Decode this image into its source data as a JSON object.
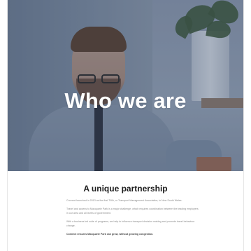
{
  "hero": {
    "title": "Who we are"
  },
  "section": {
    "title": "A unique partnership",
    "paragraphs": [
      "Connect launched in 2013 as the first TMA, or Transport Management Association, in New South Wales.",
      "Travel and access to Macquarie Park is a major challenge, which requires coordination between the leading employers in our area and all levels of government.",
      "With a business led suite of programs, we help to influence transport decision making and promote travel behaviour change."
    ],
    "closing": "Connect ensures Macquarie Park can grow, without growing congestion."
  },
  "colors": {
    "overlay": "#283755",
    "hero_text": "#ffffff",
    "heading": "#1b1b1b",
    "body_text": "#8a8a8a"
  }
}
